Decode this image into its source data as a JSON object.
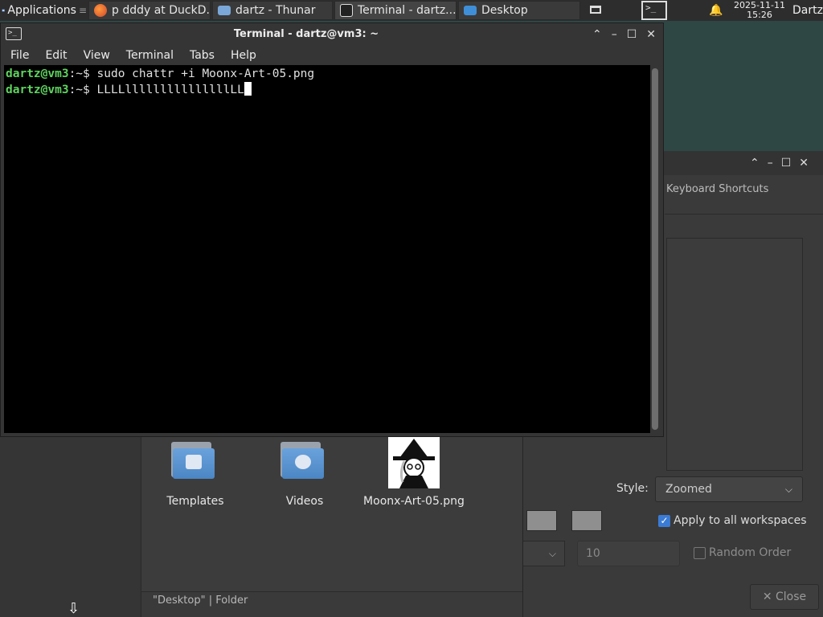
{
  "panel": {
    "applications_label": "Applications",
    "tasks": [
      {
        "label": "p dddy at DuckD...",
        "icon": "firefox-icon"
      },
      {
        "label": "dartz - Thunar",
        "icon": "folder-icon"
      },
      {
        "label": "Terminal - dartz...",
        "icon": "terminal-icon"
      },
      {
        "label": "Desktop",
        "icon": "desktop-icon"
      }
    ],
    "clock_date": "2025-11-11",
    "clock_time": "15:26",
    "user": "Dartz"
  },
  "terminal": {
    "title": "Terminal - dartz@vm3: ~",
    "menu": [
      "File",
      "Edit",
      "View",
      "Terminal",
      "Tabs",
      "Help"
    ],
    "lines": [
      {
        "prompt": "dartz@vm3",
        "path": ":~$ ",
        "command": "sudo chattr +i Moonx-Art-05.png"
      },
      {
        "prompt": "dartz@vm3",
        "path": ":~$ ",
        "command": "LLLLlllllllllllllllLL"
      }
    ]
  },
  "thunar": {
    "files": [
      {
        "name": "Templates",
        "kind": "templates-folder"
      },
      {
        "name": "Videos",
        "kind": "videos-folder"
      },
      {
        "name": "Moonx-Art-05.png",
        "kind": "image"
      }
    ],
    "status": "\"Desktop\"  |  Folder"
  },
  "desktop_settings": {
    "tab_keyboard": "Keyboard Shortcuts",
    "style_label": "Style:",
    "style_value": "Zoomed",
    "apply_all_label": "Apply to all workspaces",
    "apply_all_checked": true,
    "spin_value": "10",
    "random_order_label": "Random Order",
    "close_label": "Close"
  },
  "colors": {
    "prompt": "#5fd35f",
    "accent": "#3a7bd5"
  }
}
